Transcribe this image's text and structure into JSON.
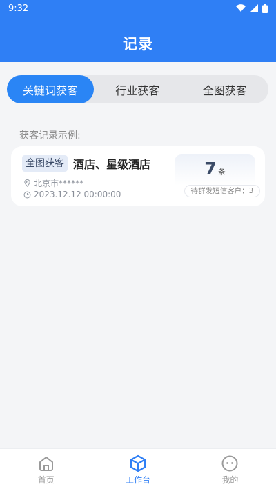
{
  "status_bar": {
    "time": "9:32"
  },
  "header": {
    "title": "记录"
  },
  "tabs": [
    {
      "label": "关键词获客",
      "active": true
    },
    {
      "label": "行业获客",
      "active": false
    },
    {
      "label": "全图获客",
      "active": false
    }
  ],
  "section": {
    "label": "获客记录示例:"
  },
  "record": {
    "tag": "全图获客",
    "title": "酒店、星级酒店",
    "location": "北京市******",
    "datetime": "2023.12.12 00:00:00",
    "count": "7",
    "count_unit": "条",
    "pending_label": "待群发短信客户：3"
  },
  "bottom_nav": [
    {
      "label": "首页",
      "icon": "home-icon",
      "active": false
    },
    {
      "label": "工作台",
      "icon": "cube-icon",
      "active": true
    },
    {
      "label": "我的",
      "icon": "profile-icon",
      "active": false
    }
  ],
  "colors": {
    "primary": "#2f7ff5",
    "tab_active": "#2a85f5",
    "background": "#f4f5f7"
  }
}
